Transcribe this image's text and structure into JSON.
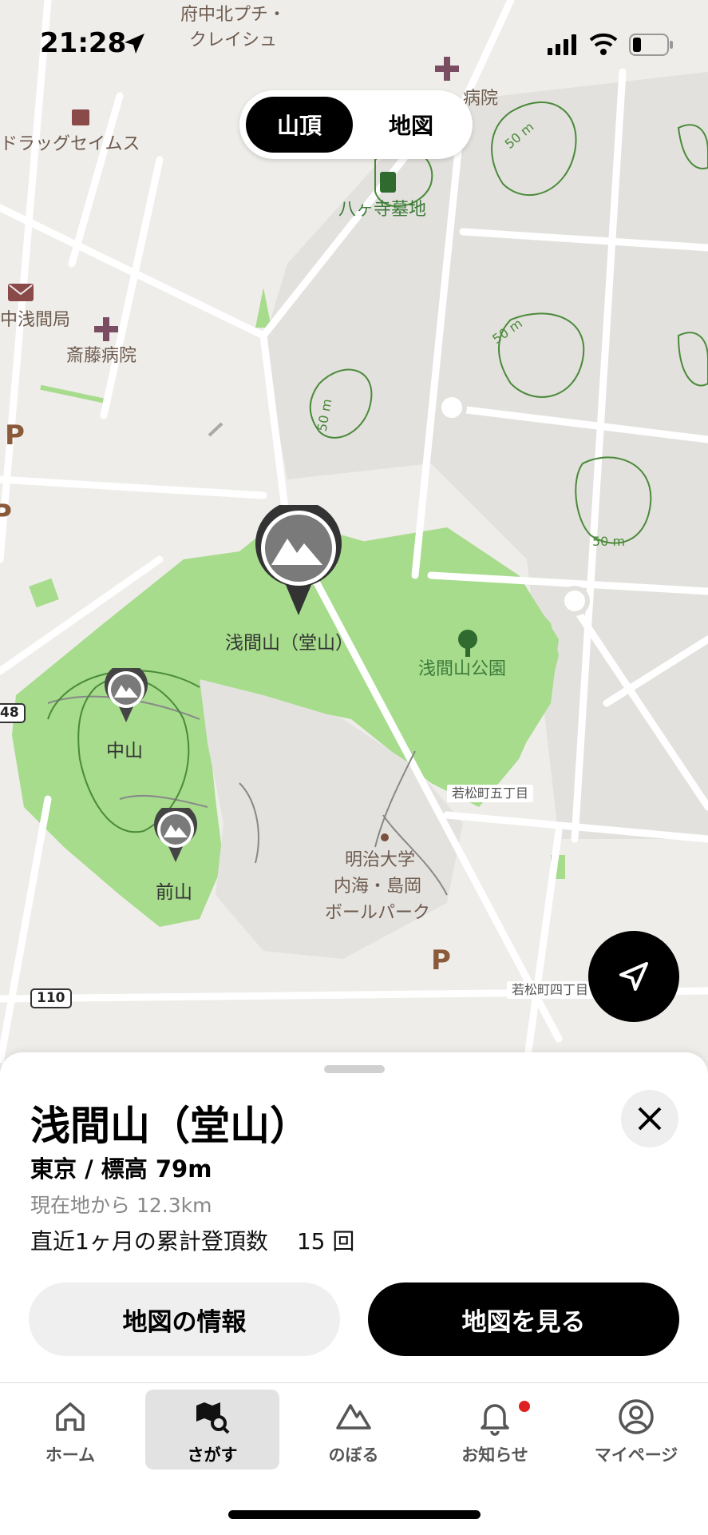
{
  "status_bar": {
    "time": "21:28"
  },
  "segment": {
    "options": [
      "山頂",
      "地図"
    ],
    "selected": "山頂"
  },
  "map": {
    "labels": {
      "fuchu_petit": "府中北プチ・",
      "creishu": "クレイシュ",
      "byoin": "病院",
      "drug": "ドラッグセイムス",
      "hachigaji": "八ヶ寺墓地",
      "naka_sengen_kyoku": "中浅間局",
      "saito": "斎藤病院",
      "sengenyama_park": "浅間山公園",
      "meiji_1": "明治大学",
      "meiji_2": "内海・島岡",
      "meiji_3": "ボールパーク",
      "wakamatsu5": "若松町五丁目",
      "wakamatsu4": "若松町四丁目"
    },
    "contours": [
      "50 m",
      "50 m",
      "50 m",
      "50 m"
    ],
    "road_shields": [
      "48",
      "110"
    ],
    "parking": [
      "P",
      "P",
      "P"
    ],
    "peaks": [
      {
        "name": "浅間山（堂山）",
        "selected": true
      },
      {
        "name": "中山",
        "selected": false
      },
      {
        "name": "前山",
        "selected": false
      }
    ]
  },
  "sheet": {
    "title": "浅間山（堂山）",
    "subtitle": "東京 / 標高 79m",
    "distance": "現在地から 12.3km",
    "summit_label": "直近1ヶ月の累計登頂数",
    "summit_count": "15 回",
    "btn_info": "地図の情報",
    "btn_view": "地図を見る"
  },
  "tabs": [
    {
      "label": "ホーム",
      "icon": "home-icon"
    },
    {
      "label": "さがす",
      "icon": "map-search-icon",
      "active": true
    },
    {
      "label": "のぼる",
      "icon": "mountain-icon"
    },
    {
      "label": "お知らせ",
      "icon": "bell-icon",
      "badge": true
    },
    {
      "label": "マイページ",
      "icon": "user-icon"
    }
  ],
  "colors": {
    "park": "#a6dc8c",
    "map_bg": "#efedea",
    "accent_red": "#e02020"
  }
}
